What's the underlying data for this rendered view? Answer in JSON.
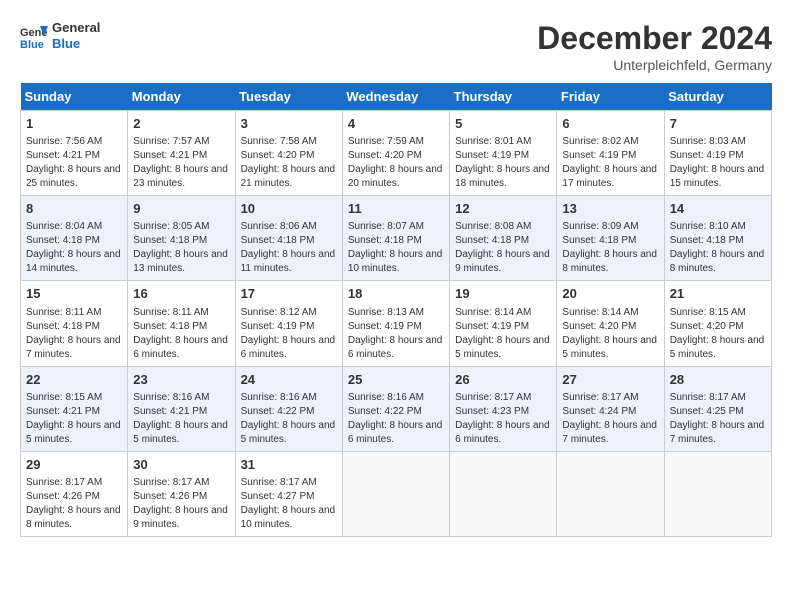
{
  "header": {
    "logo_line1": "General",
    "logo_line2": "Blue",
    "title": "December 2024",
    "subtitle": "Unterpleichfeld, Germany"
  },
  "days_of_week": [
    "Sunday",
    "Monday",
    "Tuesday",
    "Wednesday",
    "Thursday",
    "Friday",
    "Saturday"
  ],
  "weeks": [
    [
      {
        "day": "1",
        "rise": "7:56 AM",
        "set": "4:21 PM",
        "daylight": "8 hours and 25 minutes."
      },
      {
        "day": "2",
        "rise": "7:57 AM",
        "set": "4:21 PM",
        "daylight": "8 hours and 23 minutes."
      },
      {
        "day": "3",
        "rise": "7:58 AM",
        "set": "4:20 PM",
        "daylight": "8 hours and 21 minutes."
      },
      {
        "day": "4",
        "rise": "7:59 AM",
        "set": "4:20 PM",
        "daylight": "8 hours and 20 minutes."
      },
      {
        "day": "5",
        "rise": "8:01 AM",
        "set": "4:19 PM",
        "daylight": "8 hours and 18 minutes."
      },
      {
        "day": "6",
        "rise": "8:02 AM",
        "set": "4:19 PM",
        "daylight": "8 hours and 17 minutes."
      },
      {
        "day": "7",
        "rise": "8:03 AM",
        "set": "4:19 PM",
        "daylight": "8 hours and 15 minutes."
      }
    ],
    [
      {
        "day": "8",
        "rise": "8:04 AM",
        "set": "4:18 PM",
        "daylight": "8 hours and 14 minutes."
      },
      {
        "day": "9",
        "rise": "8:05 AM",
        "set": "4:18 PM",
        "daylight": "8 hours and 13 minutes."
      },
      {
        "day": "10",
        "rise": "8:06 AM",
        "set": "4:18 PM",
        "daylight": "8 hours and 11 minutes."
      },
      {
        "day": "11",
        "rise": "8:07 AM",
        "set": "4:18 PM",
        "daylight": "8 hours and 10 minutes."
      },
      {
        "day": "12",
        "rise": "8:08 AM",
        "set": "4:18 PM",
        "daylight": "8 hours and 9 minutes."
      },
      {
        "day": "13",
        "rise": "8:09 AM",
        "set": "4:18 PM",
        "daylight": "8 hours and 8 minutes."
      },
      {
        "day": "14",
        "rise": "8:10 AM",
        "set": "4:18 PM",
        "daylight": "8 hours and 8 minutes."
      }
    ],
    [
      {
        "day": "15",
        "rise": "8:11 AM",
        "set": "4:18 PM",
        "daylight": "8 hours and 7 minutes."
      },
      {
        "day": "16",
        "rise": "8:11 AM",
        "set": "4:18 PM",
        "daylight": "8 hours and 6 minutes."
      },
      {
        "day": "17",
        "rise": "8:12 AM",
        "set": "4:19 PM",
        "daylight": "8 hours and 6 minutes."
      },
      {
        "day": "18",
        "rise": "8:13 AM",
        "set": "4:19 PM",
        "daylight": "8 hours and 6 minutes."
      },
      {
        "day": "19",
        "rise": "8:14 AM",
        "set": "4:19 PM",
        "daylight": "8 hours and 5 minutes."
      },
      {
        "day": "20",
        "rise": "8:14 AM",
        "set": "4:20 PM",
        "daylight": "8 hours and 5 minutes."
      },
      {
        "day": "21",
        "rise": "8:15 AM",
        "set": "4:20 PM",
        "daylight": "8 hours and 5 minutes."
      }
    ],
    [
      {
        "day": "22",
        "rise": "8:15 AM",
        "set": "4:21 PM",
        "daylight": "8 hours and 5 minutes."
      },
      {
        "day": "23",
        "rise": "8:16 AM",
        "set": "4:21 PM",
        "daylight": "8 hours and 5 minutes."
      },
      {
        "day": "24",
        "rise": "8:16 AM",
        "set": "4:22 PM",
        "daylight": "8 hours and 5 minutes."
      },
      {
        "day": "25",
        "rise": "8:16 AM",
        "set": "4:22 PM",
        "daylight": "8 hours and 6 minutes."
      },
      {
        "day": "26",
        "rise": "8:17 AM",
        "set": "4:23 PM",
        "daylight": "8 hours and 6 minutes."
      },
      {
        "day": "27",
        "rise": "8:17 AM",
        "set": "4:24 PM",
        "daylight": "8 hours and 7 minutes."
      },
      {
        "day": "28",
        "rise": "8:17 AM",
        "set": "4:25 PM",
        "daylight": "8 hours and 7 minutes."
      }
    ],
    [
      {
        "day": "29",
        "rise": "8:17 AM",
        "set": "4:26 PM",
        "daylight": "8 hours and 8 minutes."
      },
      {
        "day": "30",
        "rise": "8:17 AM",
        "set": "4:26 PM",
        "daylight": "8 hours and 9 minutes."
      },
      {
        "day": "31",
        "rise": "8:17 AM",
        "set": "4:27 PM",
        "daylight": "8 hours and 10 minutes."
      },
      null,
      null,
      null,
      null
    ]
  ],
  "labels": {
    "sunrise": "Sunrise:",
    "sunset": "Sunset:",
    "daylight": "Daylight:"
  }
}
